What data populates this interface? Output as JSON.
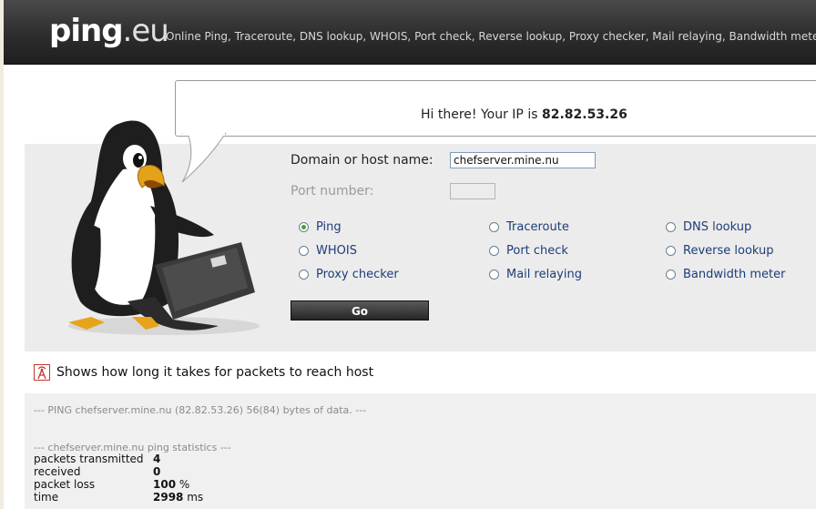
{
  "header": {
    "logo_main": "ping",
    "logo_tld": ".eu",
    "tagline": "Online Ping, Traceroute, DNS lookup, WHOIS, Port check, Reverse lookup, Proxy checker, Mail relaying, Bandwidth meter"
  },
  "greeting": {
    "text": "Hi there! Your IP is",
    "ip": "82.82.53.26"
  },
  "form": {
    "host_label": "Domain or host name:",
    "host_value": "chefserver.mine.nu",
    "port_label": "Port number:",
    "port_value": "",
    "options": [
      {
        "label": "Ping",
        "selected": true
      },
      {
        "label": "Traceroute",
        "selected": false
      },
      {
        "label": "DNS lookup",
        "selected": false
      },
      {
        "label": "WHOIS",
        "selected": false
      },
      {
        "label": "Port check",
        "selected": false
      },
      {
        "label": "Reverse lookup",
        "selected": false
      },
      {
        "label": "Proxy checker",
        "selected": false
      },
      {
        "label": "Mail relaying",
        "selected": false
      },
      {
        "label": "Bandwidth meter",
        "selected": false
      }
    ],
    "go_label": "Go"
  },
  "description": "Shows how long it takes for packets to reach host",
  "output": {
    "ping_line": "--- PING chefserver.mine.nu (82.82.53.26) 56(84) bytes of data. ---",
    "stats_title": "--- chefserver.mine.nu ping statistics ---",
    "stats": [
      {
        "label": "packets transmitted",
        "value": "4",
        "unit": ""
      },
      {
        "label": "received",
        "value": "0",
        "unit": ""
      },
      {
        "label": "packet loss",
        "value": "100",
        "unit": " %"
      },
      {
        "label": "time",
        "value": "2998",
        "unit": " ms"
      }
    ]
  },
  "colors": {
    "accent_radio": "#3aa63a",
    "link_blue": "#1c3d7a",
    "header_bg": "#2d2d2d"
  }
}
